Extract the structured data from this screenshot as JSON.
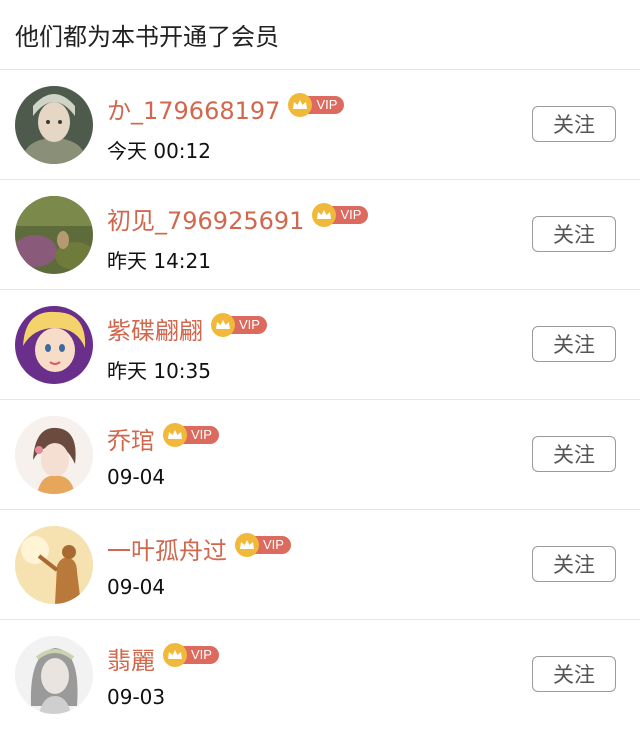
{
  "header": {
    "title": "他们都为本书开通了会员"
  },
  "vip_badge_text": "VIP",
  "follow_label": "关注",
  "colors": {
    "name": "#d0684e",
    "vip_pill": "#dd6a5e",
    "crown": "#f0b93a"
  },
  "members": [
    {
      "name": "か_179668197",
      "time": "今天 00:12",
      "avatar_icon": "fairy-portrait-avatar"
    },
    {
      "name": "初见_796925691",
      "time": "昨天 14:21",
      "avatar_icon": "nature-scene-avatar"
    },
    {
      "name": "紫碟翩翩",
      "time": "昨天 10:35",
      "avatar_icon": "cartoon-girl-avatar"
    },
    {
      "name": "乔琯",
      "time": "09-04",
      "avatar_icon": "illustrated-girl-avatar"
    },
    {
      "name": "一叶孤舟过",
      "time": "09-04",
      "avatar_icon": "sunset-silhouette-avatar"
    },
    {
      "name": "翡麗",
      "time": "09-03",
      "avatar_icon": "sketch-girl-avatar"
    }
  ]
}
